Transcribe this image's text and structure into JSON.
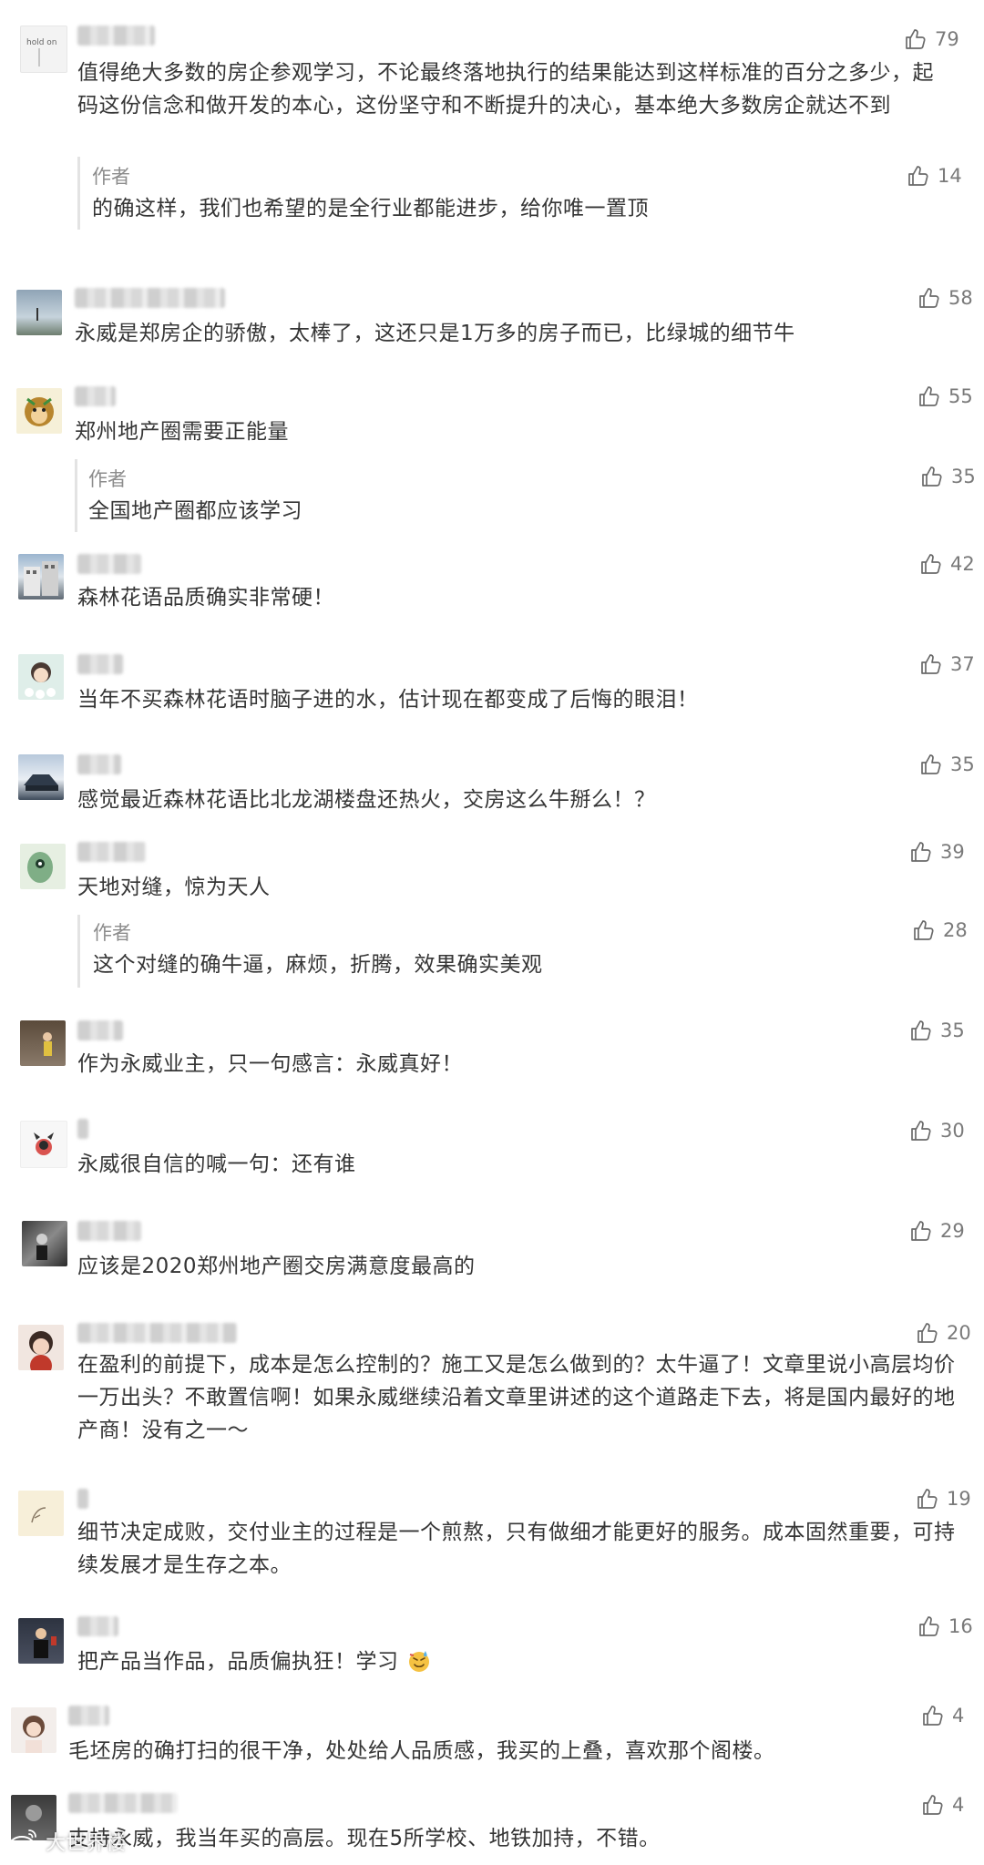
{
  "comments": [
    {
      "text": "值得绝大多数的房企参观学习，不论最终落地执行的结果能达到这样标准的百分之多少，起码这份信念和做开发的本心，这份坚守和不断提升的决心，基本绝大多数房企就达不到",
      "likes": "79",
      "avatar_icon": "hold-on-avatar-icon",
      "reply": {
        "label": "作者",
        "text": "的确这样，我们也希望的是全行业都能进步，给你唯一置顶",
        "likes": "14"
      }
    },
    {
      "text": "永威是郑房企的骄傲，太棒了，这还只是1万多的房子而已，比绿城的细节牛",
      "likes": "58",
      "avatar_icon": "landscape-avatar-icon"
    },
    {
      "text": "郑州地产圈需要正能量",
      "likes": "55",
      "avatar_icon": "monkey-avatar-icon",
      "reply": {
        "label": "作者",
        "text": "全国地产圈都应该学习",
        "likes": "35"
      }
    },
    {
      "text": "森林花语品质确实非常硬！",
      "likes": "42",
      "avatar_icon": "building-avatar-icon"
    },
    {
      "text": "当年不买森林花语时脑子进的水，估计现在都变成了后悔的眼泪！",
      "likes": "37",
      "avatar_icon": "cartoon-girl-avatar-icon"
    },
    {
      "text": "感觉最近森林花语比北龙湖楼盘还热火，交房这么牛掰么！？",
      "likes": "35",
      "avatar_icon": "snow-car-avatar-icon"
    },
    {
      "text": "天地对缝，惊为天人",
      "likes": "39",
      "avatar_icon": "green-face-avatar-icon",
      "reply": {
        "label": "作者",
        "text": "这个对缝的确牛逼，麻烦，折腾，效果确实美观",
        "likes": "28"
      }
    },
    {
      "text": "作为永威业主，只一句感言：永威真好！",
      "likes": "35",
      "avatar_icon": "person-avatar-icon"
    },
    {
      "text": "永威很自信的喊一句：还有谁",
      "likes": "30",
      "avatar_icon": "cartoon-cat-avatar-icon"
    },
    {
      "text": "应该是2020郑州地产圈交房满意度最高的",
      "likes": "29",
      "avatar_icon": "dark-photo-avatar-icon"
    },
    {
      "text": "在盈利的前提下，成本是怎么控制的？施工又是怎么做到的？太牛逼了！文章里说小高层均价一万出头？不敢置信啊！如果永威继续沿着文章里讲述的这个道路走下去，将是国内最好的地产商！没有之一～",
      "likes": "20",
      "avatar_icon": "girl-avatar-icon"
    },
    {
      "text": "细节决定成败，交付业主的过程是一个煎熬，只有做细才能更好的服务。成本固然重要，可持续发展才是生存之本。",
      "likes": "19",
      "avatar_icon": "sketch-avatar-icon"
    },
    {
      "text": "把产品当作品，品质偏执狂！学习",
      "likes": "16",
      "avatar_icon": "speaker-avatar-icon",
      "emoji": "sweat-smile-icon"
    },
    {
      "text": "毛坯房的确打扫的很干净，处处给人品质感，我买的上叠，喜欢那个阁楼。",
      "likes": "4",
      "avatar_icon": "woman-avatar-icon"
    },
    {
      "text": "支持永威，我当年买的高层。现在5所学校、地铁加持，不错。",
      "likes": "4",
      "avatar_icon": "dark-avatar-icon"
    }
  ],
  "watermark": {
    "text": "大世界楼",
    "icon": "weibo-logo-icon"
  }
}
